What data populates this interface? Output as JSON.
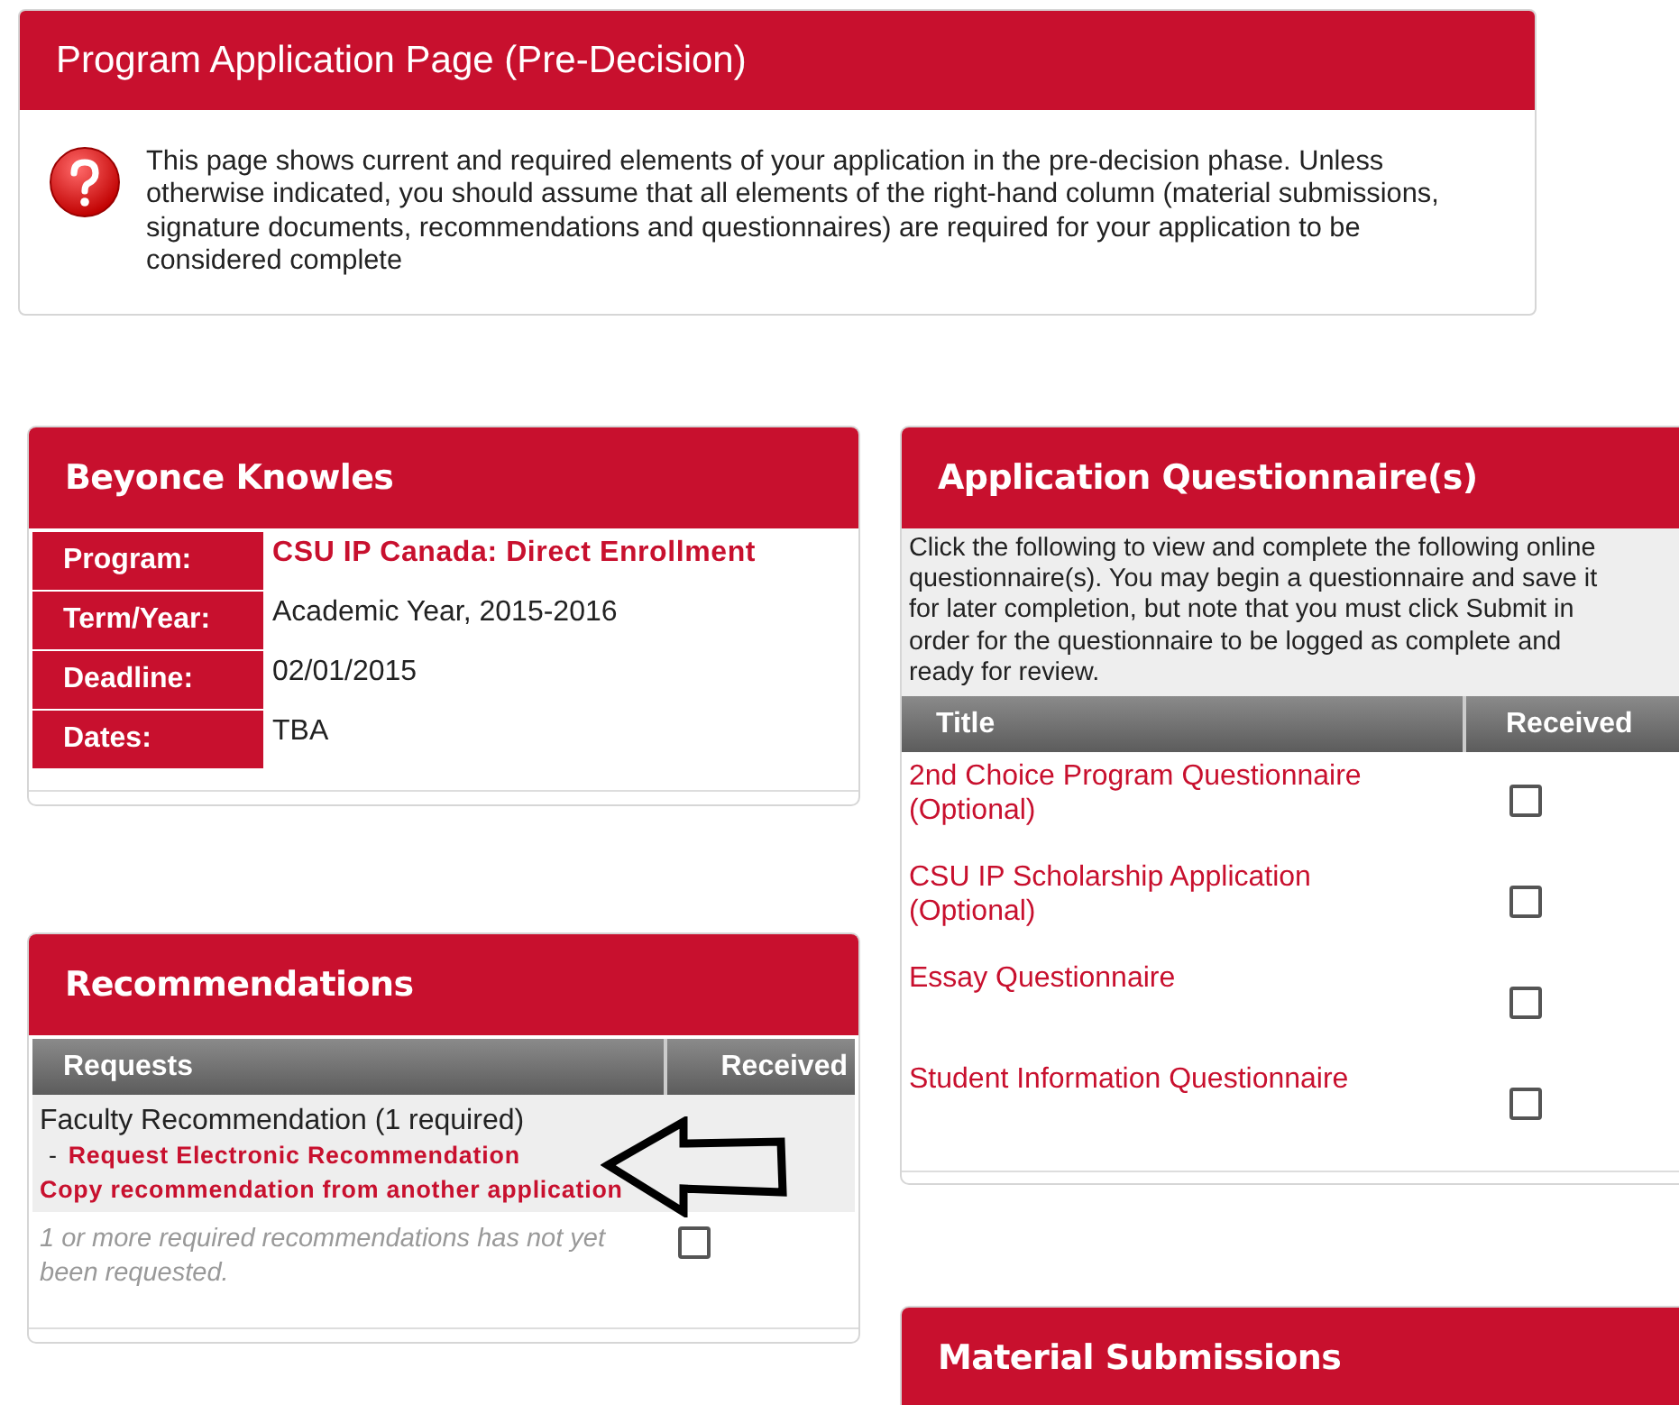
{
  "page_header": {
    "title": "Program Application Page (Pre-Decision)",
    "message": "This page shows current and required elements of your application in the pre-decision phase. Unless otherwise indicated, you should assume that all elements of the right-hand column (material submissions, signature documents, recommendations and questionnaires) are required for your application to be considered complete"
  },
  "applicant": {
    "name": "Beyonce Knowles",
    "fields": [
      {
        "label": "Program:",
        "value": "CSU IP Canada: Direct Enrollment",
        "kind": "link"
      },
      {
        "label": "Term/Year:",
        "value": "Academic Year, 2015-2016",
        "kind": "text"
      },
      {
        "label": "Deadline:",
        "value": "02/01/2015",
        "kind": "text"
      },
      {
        "label": "Dates:",
        "value": "TBA",
        "kind": "text"
      }
    ]
  },
  "recommendations": {
    "title": "Recommendations",
    "columns": [
      "Requests",
      "Received"
    ],
    "requests": [
      {
        "name": "Faculty Recommendation (1 required)",
        "prefix": "-",
        "actions": [
          "Request Electronic Recommendation",
          "Copy recommendation from another application"
        ]
      }
    ],
    "status": {
      "note": "1 or more required recommendations has not yet been requested.",
      "received": false
    }
  },
  "questionnaires": {
    "title": "Application Questionnaire(s)",
    "intro": "Click the following to view and complete the following online questionnaire(s). You may begin a questionnaire and save it for later completion, but note that you must click Submit in order for the questionnaire to be logged as complete and ready for review.",
    "columns": [
      "Title",
      "Received"
    ],
    "items": [
      {
        "title": "2nd Choice Program Questionnaire (Optional)",
        "received": false
      },
      {
        "title": "CSU IP Scholarship Application (Optional)",
        "received": false
      },
      {
        "title": "Essay Questionnaire",
        "received": false
      },
      {
        "title": "Student Information Questionnaire",
        "received": false
      }
    ]
  },
  "material_submissions": {
    "title": "Material Submissions"
  }
}
